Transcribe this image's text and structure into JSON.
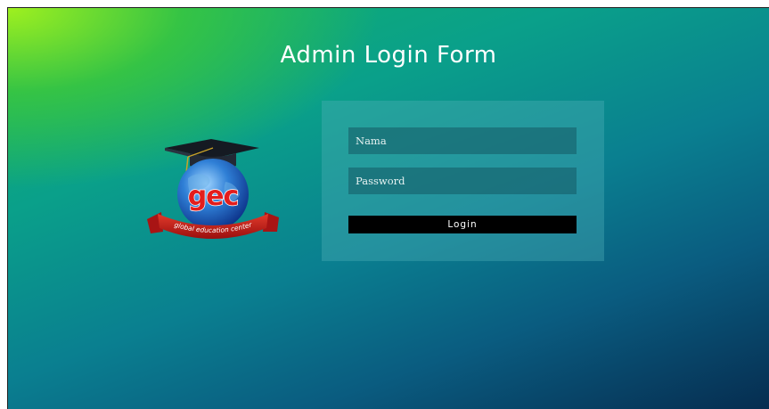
{
  "page": {
    "title": "Admin Login Form"
  },
  "logo": {
    "letters": "gec",
    "ribbon_text": "global education center",
    "icon": "gec-graduation-globe-logo"
  },
  "form": {
    "name_placeholder": "Nama",
    "name_value": "",
    "password_placeholder": "Password",
    "password_value": "",
    "login_label": "Login"
  },
  "colors": {
    "gradient_top_left": "#9ff01f",
    "gradient_mid": "#0a8f8c",
    "gradient_bottom_right": "#062d50",
    "button": "#000000",
    "title_text": "#ffffff"
  }
}
